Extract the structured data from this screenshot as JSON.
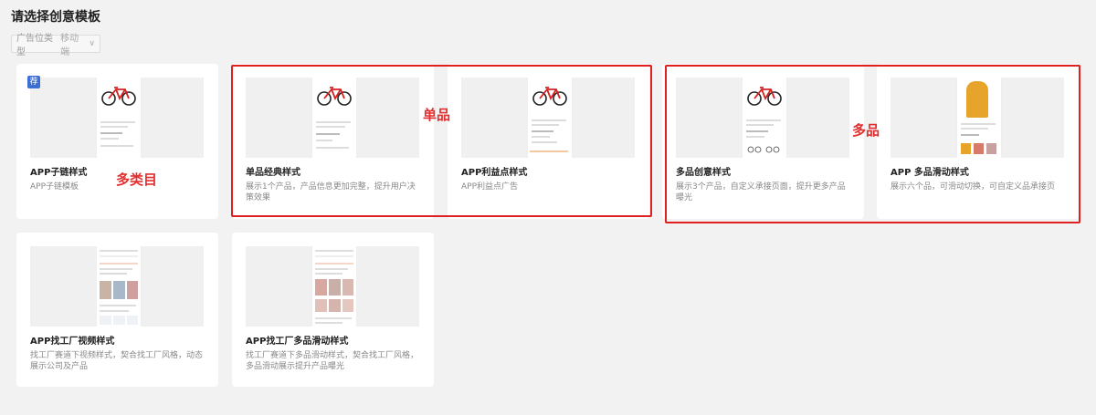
{
  "page": {
    "title": "请选择创意模板"
  },
  "filter": {
    "label": "广告位类型",
    "value": "移动端"
  },
  "cards": [
    {
      "title": "APP子链样式",
      "desc": "APP子链模板",
      "badge": "荐"
    },
    {
      "title": "单品经典样式",
      "desc": "展示1个产品，产品信息更加完整，提升用户决策效果"
    },
    {
      "title": "APP利益点样式",
      "desc": "APP利益点广告"
    },
    {
      "title": "多品创意样式",
      "desc": "展示3个产品，自定义承接页面，提升更多产品曝光"
    },
    {
      "title": "APP 多品滑动样式",
      "desc": "展示六个品，可滑动切换，可自定义品承接页"
    },
    {
      "title": "APP找工厂视频样式",
      "desc": "找工厂赛道下视频样式，契合找工厂风格，动态展示公司及产品"
    },
    {
      "title": "APP找工厂多品滑动样式",
      "desc": "找工厂赛道下多品滑动样式，契合找工厂风格，多品滑动展示提升产品曝光"
    }
  ],
  "annotations": {
    "multi_category": "多类目",
    "single": "单品",
    "multi": "多品"
  },
  "icons": {
    "chevron": "chevron-down-icon",
    "bike": "bicycle-icon",
    "dress": "dress-icon"
  },
  "colors": {
    "badge": "#3b6fd4",
    "annotation": "#e02020"
  }
}
